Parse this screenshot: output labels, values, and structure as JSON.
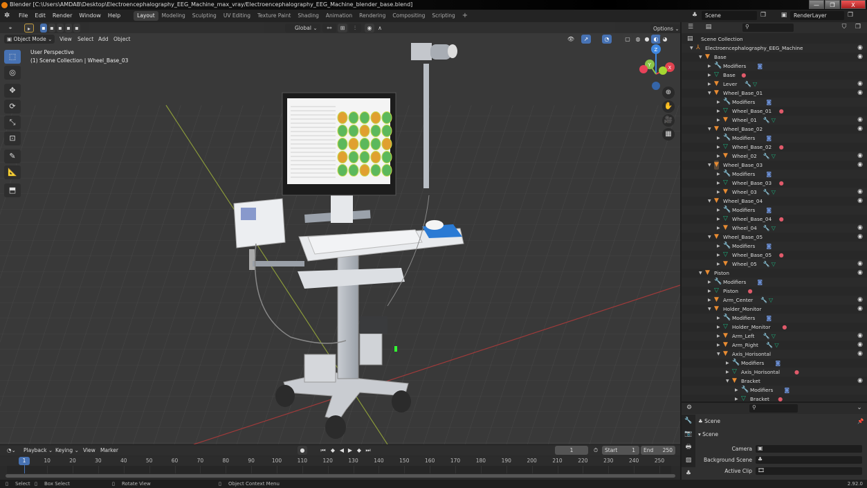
{
  "window": {
    "title": "Blender [C:\\Users\\AMDAB\\Desktop\\Electroencephalography_EEG_Machine_max_vray/Electroencephalography_EEG_Machine_blender_base.blend]",
    "minimize": "—",
    "maximize": "❐",
    "close": "X"
  },
  "menubar": {
    "items": [
      "File",
      "Edit",
      "Render",
      "Window",
      "Help"
    ],
    "workspaces": [
      "Layout",
      "Modeling",
      "Sculpting",
      "UV Editing",
      "Texture Paint",
      "Shading",
      "Animation",
      "Rendering",
      "Compositing",
      "Scripting"
    ],
    "active_workspace": "Layout",
    "add_tab": "+",
    "scene_label": "Scene",
    "view_layer_label": "RenderLayer"
  },
  "viewport": {
    "mode": "Object Mode",
    "menus": [
      "View",
      "Select",
      "Add",
      "Object"
    ],
    "transform_orientation": "Global",
    "options_label": "Options",
    "perspective_label": "User Perspective",
    "context_label": "(1) Scene Collection | Wheel_Base_03",
    "gizmo_axes": {
      "x": "X",
      "y": "Y",
      "z": "Z"
    },
    "colors": {
      "x": "#e0424f",
      "y": "#8bc34a",
      "z": "#3f87e0",
      "active_tool": "#4772b3"
    }
  },
  "outliner": {
    "search_placeholder": "",
    "root": "Scene Collection",
    "rows": [
      {
        "label": "Electroencephalography_EEG_Machine",
        "type": "empty",
        "depth": 1,
        "expanded": true,
        "eye": true
      },
      {
        "label": "Base",
        "type": "object",
        "depth": 2,
        "expanded": true,
        "eye": true
      },
      {
        "label": "Modifiers",
        "type": "modifiers",
        "depth": 3,
        "expanded": false,
        "eye": false
      },
      {
        "label": "Base",
        "type": "mesh",
        "depth": 3,
        "expanded": false,
        "eye": false,
        "material": true
      },
      {
        "label": "Lever",
        "type": "object",
        "depth": 3,
        "expanded": false,
        "eye": true,
        "extras": true
      },
      {
        "label": "Wheel_Base_01",
        "type": "object",
        "depth": 3,
        "expanded": true,
        "eye": true
      },
      {
        "label": "Modifiers",
        "type": "modifiers",
        "depth": 4,
        "expanded": false,
        "eye": false
      },
      {
        "label": "Wheel_Base_01",
        "type": "mesh",
        "depth": 4,
        "expanded": false,
        "eye": false,
        "material": true
      },
      {
        "label": "Wheel_01",
        "type": "object",
        "depth": 4,
        "expanded": false,
        "eye": true,
        "extras": true
      },
      {
        "label": "Wheel_Base_02",
        "type": "object",
        "depth": 3,
        "expanded": true,
        "eye": true
      },
      {
        "label": "Modifiers",
        "type": "modifiers",
        "depth": 4,
        "expanded": false,
        "eye": false
      },
      {
        "label": "Wheel_Base_02",
        "type": "mesh",
        "depth": 4,
        "expanded": false,
        "eye": false,
        "material": true
      },
      {
        "label": "Wheel_02",
        "type": "object",
        "depth": 4,
        "expanded": false,
        "eye": true,
        "extras": true
      },
      {
        "label": "Wheel_Base_03",
        "type": "object",
        "depth": 3,
        "expanded": true,
        "eye": true,
        "active": true
      },
      {
        "label": "Modifiers",
        "type": "modifiers",
        "depth": 4,
        "expanded": false,
        "eye": false
      },
      {
        "label": "Wheel_Base_03",
        "type": "mesh",
        "depth": 4,
        "expanded": false,
        "eye": false,
        "material": true
      },
      {
        "label": "Wheel_03",
        "type": "object",
        "depth": 4,
        "expanded": false,
        "eye": true,
        "extras": true
      },
      {
        "label": "Wheel_Base_04",
        "type": "object",
        "depth": 3,
        "expanded": true,
        "eye": true
      },
      {
        "label": "Modifiers",
        "type": "modifiers",
        "depth": 4,
        "expanded": false,
        "eye": false
      },
      {
        "label": "Wheel_Base_04",
        "type": "mesh",
        "depth": 4,
        "expanded": false,
        "eye": false,
        "material": true
      },
      {
        "label": "Wheel_04",
        "type": "object",
        "depth": 4,
        "expanded": false,
        "eye": true,
        "extras": true
      },
      {
        "label": "Wheel_Base_05",
        "type": "object",
        "depth": 3,
        "expanded": true,
        "eye": true
      },
      {
        "label": "Modifiers",
        "type": "modifiers",
        "depth": 4,
        "expanded": false,
        "eye": false
      },
      {
        "label": "Wheel_Base_05",
        "type": "mesh",
        "depth": 4,
        "expanded": false,
        "eye": false,
        "material": true
      },
      {
        "label": "Wheel_05",
        "type": "object",
        "depth": 4,
        "expanded": false,
        "eye": true,
        "extras": true
      },
      {
        "label": "Piston",
        "type": "object",
        "depth": 2,
        "expanded": true,
        "eye": true
      },
      {
        "label": "Modifiers",
        "type": "modifiers",
        "depth": 3,
        "expanded": false,
        "eye": false
      },
      {
        "label": "Piston",
        "type": "mesh",
        "depth": 3,
        "expanded": false,
        "eye": false,
        "material": true
      },
      {
        "label": "Arm_Center",
        "type": "object",
        "depth": 3,
        "expanded": false,
        "eye": true,
        "extras": true
      },
      {
        "label": "Holder_Monitor",
        "type": "object",
        "depth": 3,
        "expanded": true,
        "eye": true
      },
      {
        "label": "Modifiers",
        "type": "modifiers",
        "depth": 4,
        "expanded": false,
        "eye": false
      },
      {
        "label": "Holder_Monitor",
        "type": "mesh",
        "depth": 4,
        "expanded": false,
        "eye": false,
        "material": true
      },
      {
        "label": "Arm_Left",
        "type": "object",
        "depth": 4,
        "expanded": false,
        "eye": true,
        "extras": true
      },
      {
        "label": "Arm_Right",
        "type": "object",
        "depth": 4,
        "expanded": false,
        "eye": true,
        "extras": true
      },
      {
        "label": "Axis_Horisontal",
        "type": "object",
        "depth": 4,
        "expanded": true,
        "eye": true
      },
      {
        "label": "Modifiers",
        "type": "modifiers",
        "depth": 5,
        "expanded": false,
        "eye": false
      },
      {
        "label": "Axis_Horisontal",
        "type": "mesh",
        "depth": 5,
        "expanded": false,
        "eye": false,
        "material": true
      },
      {
        "label": "Bracket",
        "type": "object",
        "depth": 5,
        "expanded": true,
        "eye": true
      },
      {
        "label": "Modifiers",
        "type": "modifiers",
        "depth": 6,
        "expanded": false,
        "eye": false
      },
      {
        "label": "Bracket",
        "type": "mesh",
        "depth": 6,
        "expanded": false,
        "eye": false,
        "material": true
      }
    ]
  },
  "properties": {
    "search_placeholder": "",
    "context": "Scene",
    "panel": "Scene",
    "fields": [
      {
        "label": "Camera",
        "value": ""
      },
      {
        "label": "Background Scene",
        "value": ""
      },
      {
        "label": "Active Clip",
        "value": ""
      }
    ],
    "version": "2.92.0"
  },
  "timeline": {
    "menus": [
      "Playback",
      "Keying",
      "View",
      "Marker"
    ],
    "current_frame": "1",
    "start_label": "Start",
    "start": "1",
    "end_label": "End",
    "end": "250",
    "ticks": [
      "10",
      "20",
      "30",
      "40",
      "50",
      "60",
      "70",
      "80",
      "90",
      "100",
      "110",
      "120",
      "130",
      "140",
      "150",
      "160",
      "170",
      "180",
      "190",
      "200",
      "210",
      "220",
      "230",
      "240",
      "250"
    ],
    "cursor": "1"
  },
  "statusbar": {
    "select": "Select",
    "box_select": "Box Select",
    "rotate": "Rotate View",
    "context_menu": "Object Context Menu"
  }
}
